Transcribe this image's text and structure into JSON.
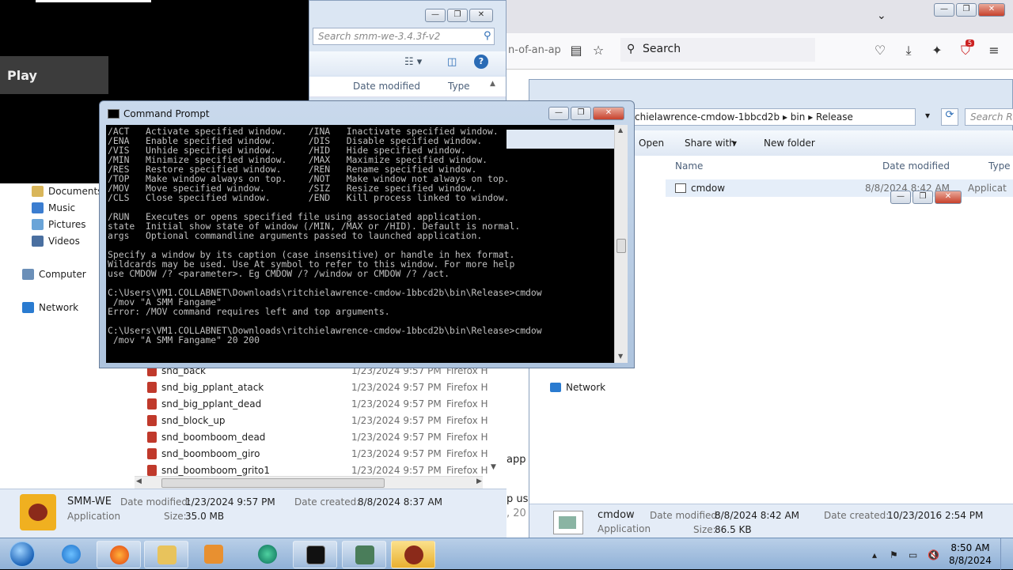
{
  "game": {
    "play_label": "Play"
  },
  "firefox": {
    "url_fragment": "n-of-an-ap",
    "search_label": "Search",
    "badge": "5",
    "page_fragments": [
      "app in",
      "p use",
      ", 20"
    ]
  },
  "explorer_smm": {
    "search_placeholder": "Search smm-we-3.4.3f-v2",
    "col_date": "Date modified",
    "col_type": "Type",
    "nav": [
      {
        "label": "Documents",
        "icon": "documents-icon"
      },
      {
        "label": "Music",
        "icon": "music-icon"
      },
      {
        "label": "Pictures",
        "icon": "pictures-icon"
      },
      {
        "label": "Videos",
        "icon": "videos-icon"
      },
      {
        "label": "Computer",
        "icon": "computer-icon"
      },
      {
        "label": "Network",
        "icon": "network-icon"
      }
    ],
    "files": [
      {
        "name": "snd_back",
        "date": "1/23/2024 9:57 PM",
        "type": "Firefox H"
      },
      {
        "name": "snd_big_pplant_atack",
        "date": "1/23/2024 9:57 PM",
        "type": "Firefox H"
      },
      {
        "name": "snd_big_pplant_dead",
        "date": "1/23/2024 9:57 PM",
        "type": "Firefox H"
      },
      {
        "name": "snd_block_up",
        "date": "1/23/2024 9:57 PM",
        "type": "Firefox H"
      },
      {
        "name": "snd_boomboom_dead",
        "date": "1/23/2024 9:57 PM",
        "type": "Firefox H"
      },
      {
        "name": "snd_boomboom_giro",
        "date": "1/23/2024 9:57 PM",
        "type": "Firefox H"
      },
      {
        "name": "snd_boomboom_grito1",
        "date": "1/23/2024 9:57 PM",
        "type": "Firefox H"
      }
    ],
    "details": {
      "name": "SMM-WE",
      "kind": "Application",
      "date_modified_label": "Date modified:",
      "date_modified": "1/23/2024 9:57 PM",
      "date_created_label": "Date created:",
      "date_created": "8/8/2024 8:37 AM",
      "size_label": "Size:",
      "size": "35.0 MB"
    }
  },
  "explorer_cmdow": {
    "breadcrumb": [
      "chielawrence-cmdow-1bbcd2b",
      "bin",
      "Release"
    ],
    "search_placeholder": "Search Re",
    "toolbar": {
      "open": "Open",
      "share": "Share with",
      "new_folder": "New folder"
    },
    "col_name": "Name",
    "col_date": "Date modified",
    "col_type": "Type",
    "file": {
      "name": "cmdow",
      "date": "8/8/2024 8:42 AM",
      "type": "Applicat"
    },
    "nav_network": "Network",
    "details": {
      "name": "cmdow",
      "kind": "Application",
      "date_modified_label": "Date modified:",
      "date_modified": "8/8/2024 8:42 AM",
      "date_created_label": "Date created:",
      "date_created": "10/23/2016 2:54 PM",
      "size_label": "Size:",
      "size": "86.5 KB"
    }
  },
  "cmd": {
    "title": "Command Prompt",
    "lines": [
      "/ACT   Activate specified window.    /INA   Inactivate specified window.",
      "/ENA   Enable specified window.      /DIS   Disable specified window.",
      "/VIS   Unhide specified window.      /HID   Hide specified window.",
      "/MIN   Minimize specified window.    /MAX   Maximize specified window.",
      "/RES   Restore specified window.     /REN   Rename specified window.",
      "/TOP   Make window always on top.    /NOT   Make window not always on top.",
      "/MOV   Move specified window.        /SIZ   Resize specified window.",
      "/CLS   Close specified window.       /END   Kill process linked to window.",
      "",
      "/RUN   Executes or opens specified file using associated application.",
      "state  Initial show state of window (/MIN, /MAX or /HID). Default is normal.",
      "args   Optional commandline arguments passed to launched application.",
      "",
      "Specify a window by its caption (case insensitive) or handle in hex format.",
      "Wildcards may be used. Use At symbol to refer to this window. For more help",
      "use CMDOW /? <parameter>. Eg CMDOW /? /window or CMDOW /? /act.",
      "",
      "C:\\Users\\VM1.COLLABNET\\Downloads\\ritchielawrence-cmdow-1bbcd2b\\bin\\Release>cmdow",
      " /mov \"A SMM Fangame\"",
      "Error: /MOV command requires left and top arguments.",
      "",
      "C:\\Users\\VM1.COLLABNET\\Downloads\\ritchielawrence-cmdow-1bbcd2b\\bin\\Release>cmdow",
      " /mov \"A SMM Fangame\" 20 200"
    ]
  },
  "taskbar": {
    "time": "8:50 AM",
    "date": "8/8/2024",
    "apps": [
      "start-orb",
      "internet-explorer",
      "firefox",
      "file-explorer",
      "media-player",
      "chrome-app",
      "command-prompt",
      "cmd-explorer",
      "smm-we"
    ]
  }
}
